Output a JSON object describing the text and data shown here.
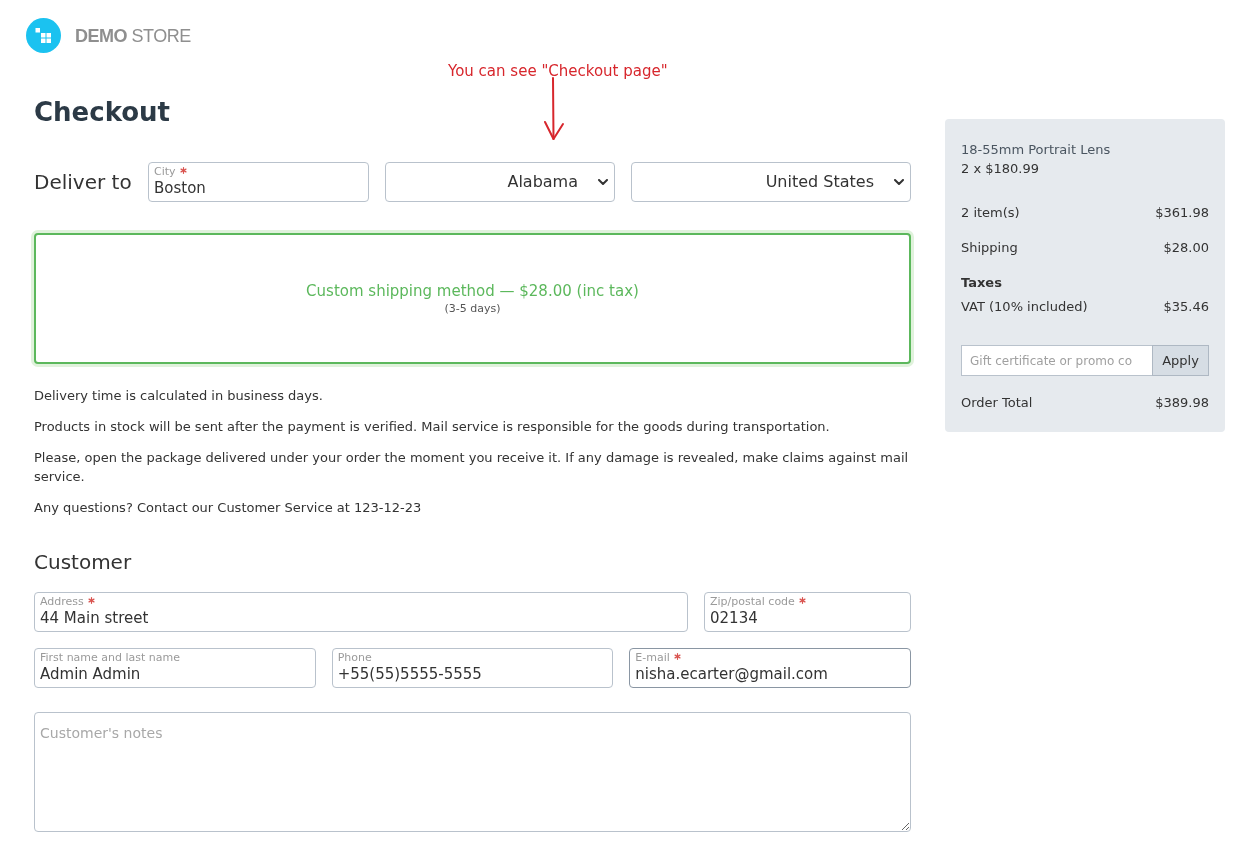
{
  "header": {
    "logo_text": "**DEMO** STORE"
  },
  "annotation": {
    "text": "You can see \"Checkout page\""
  },
  "title": "Checkout",
  "delivery": {
    "label": "Deliver to",
    "fields": [
      {
        "kind": "input",
        "label": "City",
        "required": true,
        "value": "Boston"
      },
      {
        "kind": "select",
        "value": "Alabama"
      },
      {
        "kind": "select",
        "value": "United States"
      }
    ],
    "shipping_methods": [
      {
        "title": "Custom shipping method — $28.00 (inc tax)",
        "duration": "(3-5 days)",
        "selected": true
      }
    ],
    "info": [
      "Delivery time is calculated in business days.",
      "Products in stock will be sent after the payment is verified. Mail service is responsible for the goods during transportation.",
      "Please, open the package delivered under your order the moment you receive it. If any damage is revealed, make claims against mail service.",
      "Any questions? Contact our Customer Service at 123-12-23"
    ]
  },
  "customer": {
    "heading": "Customer",
    "rows": [
      {
        "fields": [
          {
            "label": "Address",
            "required": true,
            "value": "44 Main street",
            "focused": false
          },
          {
            "label": "Zip/postal code",
            "required": true,
            "value": "02134",
            "focused": false
          }
        ]
      },
      {
        "fields": [
          {
            "label": "First name and last name",
            "required": false,
            "value": "Admin Admin",
            "focused": false
          },
          {
            "label": "Phone",
            "required": false,
            "value": "+55(55)5555-5555",
            "focused": false
          },
          {
            "label": "E-mail",
            "required": true,
            "value": "nisha.ecarter@gmail.com",
            "focused": true
          }
        ]
      }
    ],
    "notes_field": {
      "placeholder": "Customer's notes"
    }
  },
  "order_summary": {
    "items": [
      {
        "name": "18-55mm Portrait Lens",
        "quantity_price": "2 x $180.99"
      }
    ],
    "lines": [
      {
        "label": "2 item(s)",
        "amount": "$361.98"
      },
      {
        "label": "Shipping",
        "amount": "$28.00"
      }
    ],
    "taxes": {
      "heading": "Taxes",
      "lines": [
        {
          "label": "VAT (10% included)",
          "amount": "$35.46"
        }
      ]
    },
    "promo": {
      "placeholder": "Gift certificate or promo co",
      "button": "Apply"
    },
    "total": {
      "label": "Order Total",
      "amount": "$389.98"
    }
  }
}
